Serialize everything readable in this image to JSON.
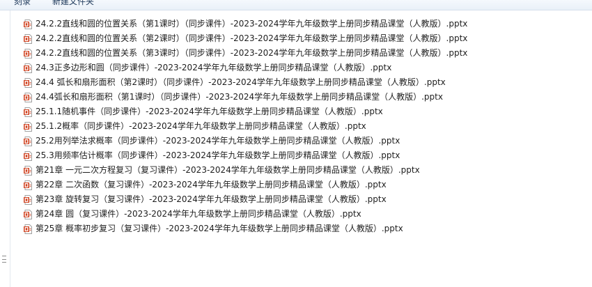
{
  "toolbar": {
    "burn_label": "刻录",
    "new_folder_label": "新建文件夹"
  },
  "icons": {
    "file_icon": "pptx-file-icon",
    "accent": "#d24726"
  },
  "files": [
    "24.2.2直线和圆的位置关系（第1课时）（同步课件）-2023-2024学年九年级数学上册同步精品课堂（人教版）.pptx",
    "24.2.2直线和圆的位置关系（第2课时）（同步课件）-2023-2024学年九年级数学上册同步精品课堂（人教版）.pptx",
    "24.2.2直线和圆的位置关系（第3课时）（同步课件）-2023-2024学年九年级数学上册同步精品课堂（人教版）.pptx",
    "24.3正多边形和圆（同步课件）-2023-2024学年九年级数学上册同步精品课堂（人教版）.pptx",
    "24.4 弧长和扇形面积（第2课时）（同步课件）-2023-2024学年九年级数学上册同步精品课堂（人教版）.pptx",
    "24.4弧长和扇形面积（第1课时）（同步课件）-2023-2024学年九年级数学上册同步精品课堂（人教版）.pptx",
    "25.1.1随机事件（同步课件）-2023-2024学年九年级数学上册同步精品课堂（人教版）.pptx",
    "25.1.2概率（同步课件）-2023-2024学年九年级数学上册同步精品课堂（人教版）.pptx",
    "25.2用列举法求概率（同步课件）-2023-2024学年九年级数学上册同步精品课堂（人教版）.pptx",
    "25.3用频率估计概率（同步课件）-2023-2024学年九年级数学上册同步精品课堂（人教版）.pptx",
    "第21章 一元二次方程复习（复习课件）-2023-2024学年九年级数学上册同步精品课堂（人教版）.pptx",
    "第22章 二次函数（复习课件）-2023-2024学年九年级数学上册同步精品课堂（人教版）.pptx",
    "第23章 旋转复习（复习课件）-2023-2024学年九年级数学上册同步精品课堂（人教版）.pptx",
    "第24章 圆（复习课件）-2023-2024学年九年级数学上册同步精品课堂（人教版）.pptx",
    "第25章 概率初步复习（复习课件）-2023-2024学年九年级数学上册同步精品课堂（人教版）.pptx"
  ]
}
